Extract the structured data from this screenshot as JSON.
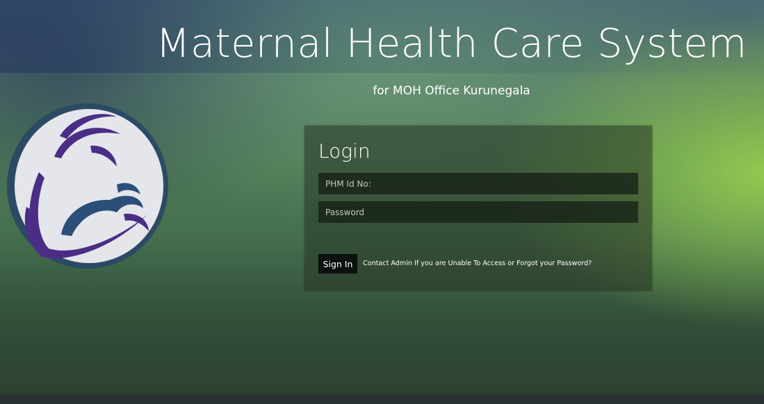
{
  "header": {
    "title": "Maternal Health Care System",
    "subtitle": "for MOH Office Kurunegala"
  },
  "logo": {
    "icon": "mother-and-child-icon",
    "colors": {
      "ring": "#2c4a63",
      "disc": "#e4e6ec",
      "stroke_primary": "#4b2d85",
      "stroke_secondary": "#2b4f78"
    }
  },
  "login": {
    "title": "Login",
    "id_field": {
      "value": "",
      "placeholder": "PHM Id No:"
    },
    "password_field": {
      "value": "",
      "placeholder": "Password"
    },
    "signin_label": "Sign In",
    "help_text": "Contact Admin If you are Unable To Access or Forgot your Password?"
  },
  "theme": {
    "panel_bg": "#2c3a27",
    "input_bg": "#161d15",
    "button_bg": "#0d110d",
    "accent_green": "#96cd50"
  }
}
